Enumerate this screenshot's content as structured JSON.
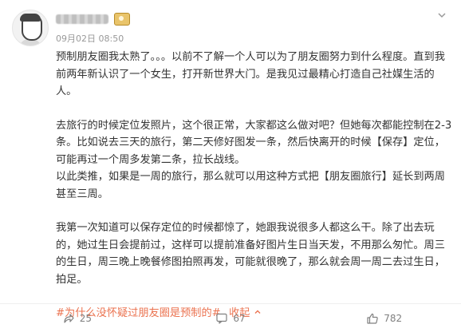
{
  "post": {
    "timestamp": "09月02日 08:50",
    "paragraphs": [
      "预制朋友圈我太熟了。。。以前不了解一个人可以为了朋友圈努力到什么程度。直到我前两年新认识了一个女生，打开新世界大门。是我见过最精心打造自己社媒生活的人。",
      "去旅行的时候定位发照片，这个很正常，大家都这么做对吧？但她每次都能控制在2-3条。比如说去三天的旅行，第二天修好图发一条，然后快离开的时候【保存】定位，可能再过一个周多发第二条，拉长战线。",
      "以此类推，如果是一周的旅行，那么就可以用这种方式把【朋友圈旅行】延长到两周甚至三周。",
      "我第一次知道可以保存定位的时候都惊了，她跟我说很多人都这么干。除了出去玩的，她过生日会提前过，这样可以提前准备好图片生日当天发，不用那么匆忙。周三的生日，周三晚上晚餐修图拍照再发，可能就很晚了，那么就会周一周二去过生日，拍足。"
    ],
    "hashtag": "#为什么没怀疑过朋友圈是预制的#",
    "fold_label": "收起",
    "fold_icon": "^"
  },
  "actions": {
    "share_count": "25",
    "comment_count": "67",
    "like_count": "782"
  },
  "icons": [
    "avatar",
    "member-badge-icon",
    "more-chevron-icon",
    "share-icon",
    "comment-icon",
    "like-icon"
  ],
  "colors": {
    "accent": "#eb7350",
    "text": "#333333",
    "muted": "#999999"
  }
}
